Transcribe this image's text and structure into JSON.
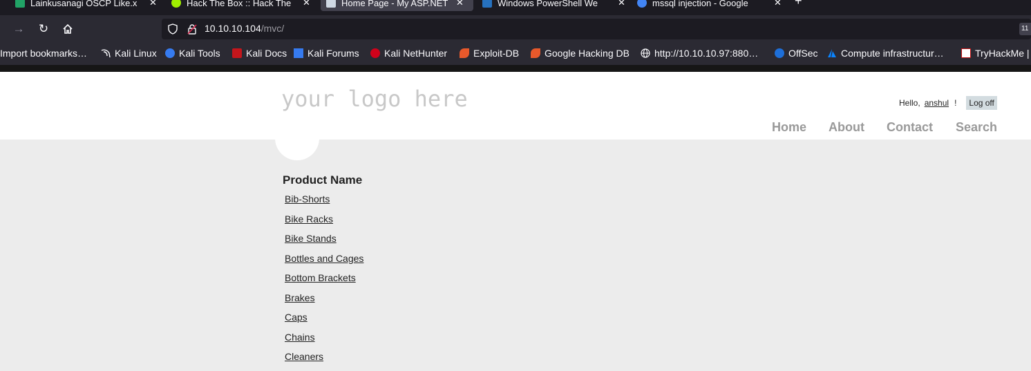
{
  "tabs": [
    {
      "title": "Lainkusanagi OSCP Like.x",
      "icon": "spreadsheet-icon",
      "color": "#21a366"
    },
    {
      "title": "Hack The Box :: Hack The",
      "icon": "hackthebox-icon",
      "color": "#9fef00"
    },
    {
      "title": "Home Page - My ASP.NET",
      "icon": "page-icon",
      "color": "#cfd8e3",
      "active": true
    },
    {
      "title": "Windows PowerShell We",
      "icon": "powershell-icon",
      "color": "#2671be"
    },
    {
      "title": "mssql injection - Google",
      "icon": "google-icon",
      "color": "#4285f4"
    }
  ],
  "address": {
    "host": "10.10.10.104",
    "path": "/mvc/",
    "zoom_badge": "11"
  },
  "bookmarks": [
    {
      "label": "Import bookmarks…",
      "icon": "import-icon"
    },
    {
      "label": "Kali Linux",
      "icon": "kali-dragon-icon"
    },
    {
      "label": "Kali Tools",
      "icon": "kali-tools-icon"
    },
    {
      "label": "Kali Docs",
      "icon": "kali-docs-icon"
    },
    {
      "label": "Kali Forums",
      "icon": "kali-forums-icon"
    },
    {
      "label": "Kali NetHunter",
      "icon": "nethunter-icon"
    },
    {
      "label": "Exploit-DB",
      "icon": "exploitdb-icon"
    },
    {
      "label": "Google Hacking DB",
      "icon": "ghdb-icon"
    },
    {
      "label": "http://10.10.10.97:880…",
      "icon": "globe-icon"
    },
    {
      "label": "OffSec",
      "icon": "offsec-icon"
    },
    {
      "label": "Compute infrastructur…",
      "icon": "azure-icon"
    },
    {
      "label": "TryHackMe |",
      "icon": "tryhackme-icon"
    }
  ],
  "site": {
    "logo": "your logo here",
    "hello": "Hello,",
    "user": "anshul",
    "exclaim": "!",
    "logoff": "Log off",
    "menu": [
      "Home",
      "About",
      "Contact",
      "Search"
    ]
  },
  "products": {
    "heading": "Product Name",
    "items": [
      "Bib-Shorts",
      "Bike Racks",
      "Bike Stands",
      "Bottles and Cages",
      "Bottom Brackets",
      "Brakes",
      "Caps",
      "Chains",
      "Cleaners"
    ]
  },
  "colors": {
    "chrome_dark": "#1c1b22",
    "chrome": "#2b2a33",
    "page_bg": "#ececec",
    "menu_text": "#999999"
  }
}
